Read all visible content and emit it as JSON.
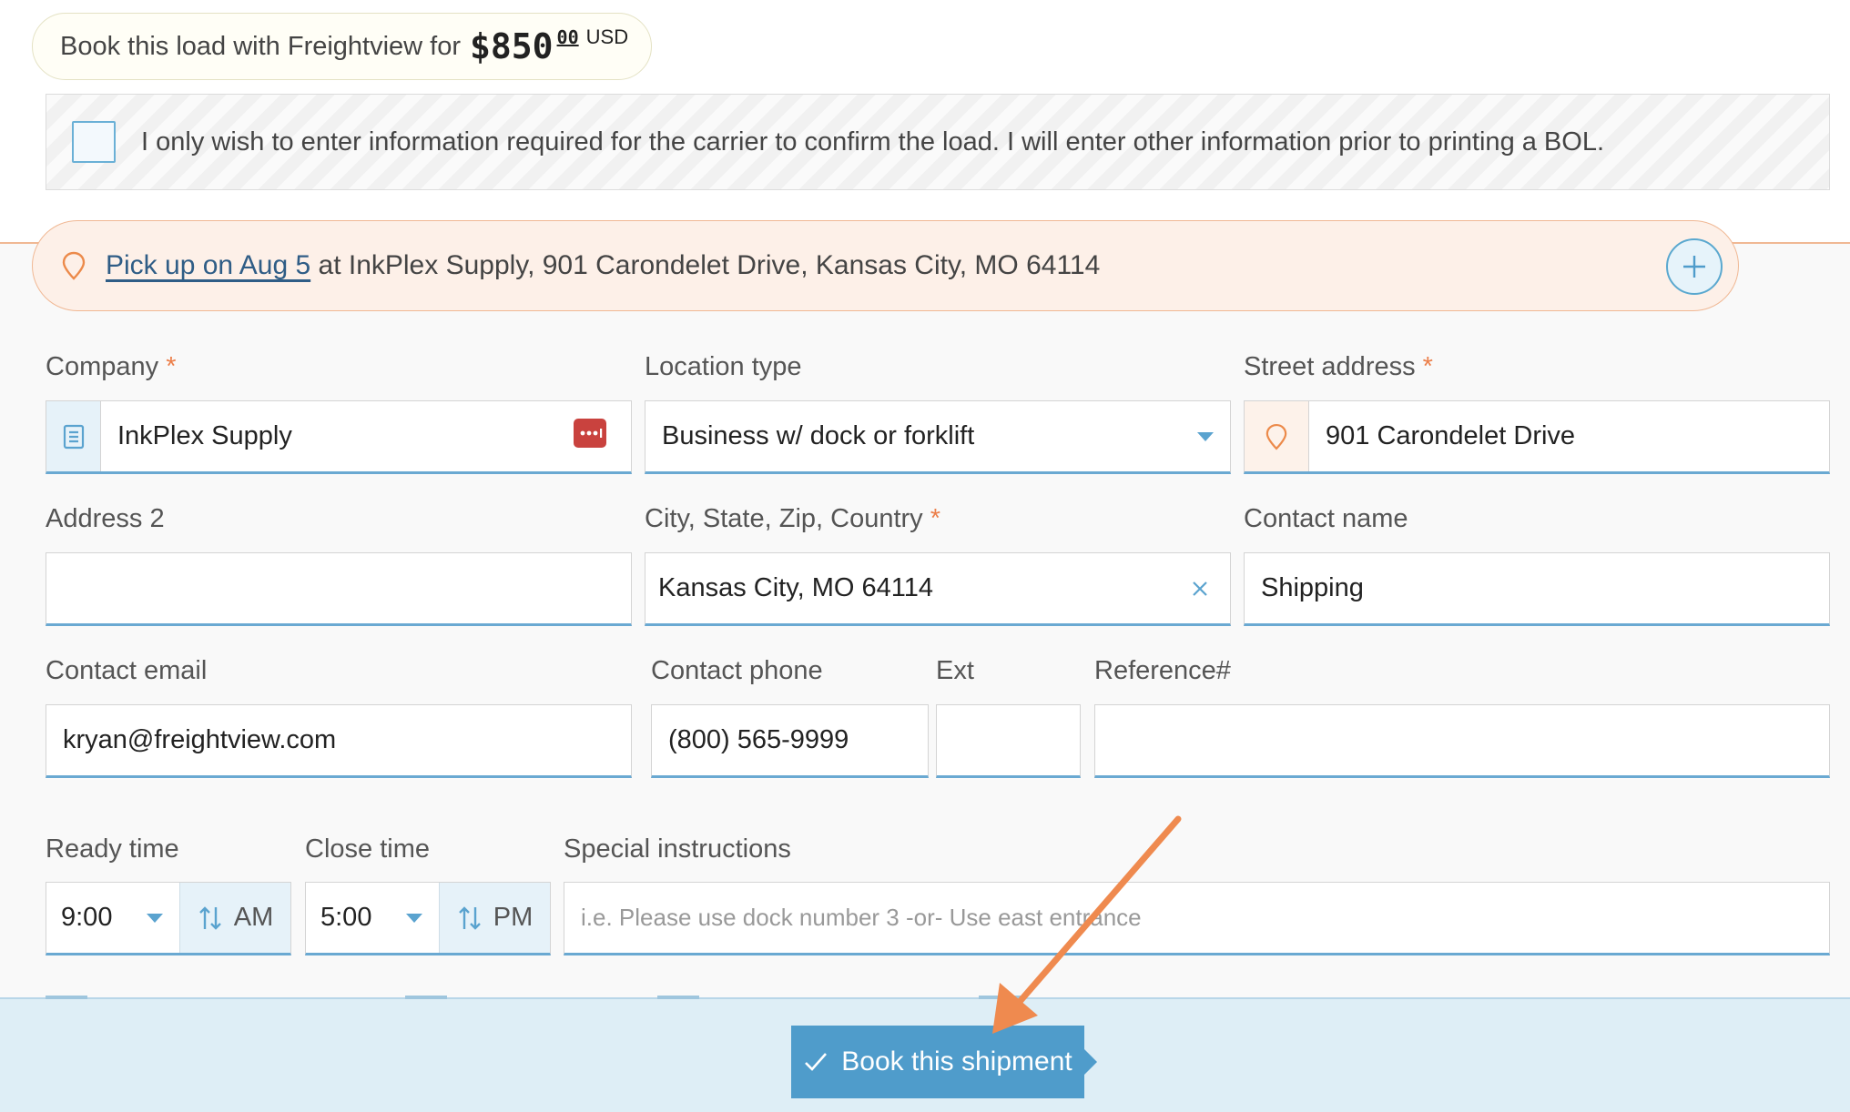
{
  "price": {
    "prefix": "Book this load with Freightview for",
    "amount": "$850",
    "cents": "00",
    "currency": "USD"
  },
  "partial_info": {
    "text": "I only wish to enter information required for the carrier to confirm the load. I will enter other information prior to printing a BOL.",
    "checked": false
  },
  "pickup": {
    "link": "Pick up on Aug 5",
    "rest": " at InkPlex Supply, 901 Carondelet Drive, Kansas City, MO 64114"
  },
  "form": {
    "company": {
      "label": "Company",
      "required": "*",
      "value": "InkPlex Supply"
    },
    "location_type": {
      "label": "Location type",
      "value": "Business w/ dock or forklift"
    },
    "street": {
      "label": "Street address",
      "required": "*",
      "value": "901 Carondelet Drive"
    },
    "address2": {
      "label": "Address 2",
      "value": ""
    },
    "city": {
      "label": "City, State, Zip, Country",
      "required": "*",
      "value": "Kansas City, MO 64114"
    },
    "contact_name": {
      "label": "Contact name",
      "value": "Shipping"
    },
    "contact_email": {
      "label": "Contact email",
      "value": "kryan@freightview.com"
    },
    "contact_phone": {
      "label": "Contact phone",
      "value": "(800) 565-9999"
    },
    "ext": {
      "label": "Ext",
      "value": ""
    },
    "reference": {
      "label": "Reference#",
      "value": ""
    },
    "ready_time": {
      "label": "Ready time",
      "value": "9:00",
      "meridiem": "AM"
    },
    "close_time": {
      "label": "Close time",
      "value": "5:00",
      "meridiem": "PM"
    },
    "special": {
      "label": "Special instructions",
      "placeholder": "i.e. Please use dock number 3 -or- Use east entrance"
    }
  },
  "actions": {
    "book_label": "Book this shipment"
  },
  "colors": {
    "accent_blue": "#4f9ccb",
    "accent_orange": "#ec7f4a",
    "annotation_arrow": "#ef8a4f"
  }
}
